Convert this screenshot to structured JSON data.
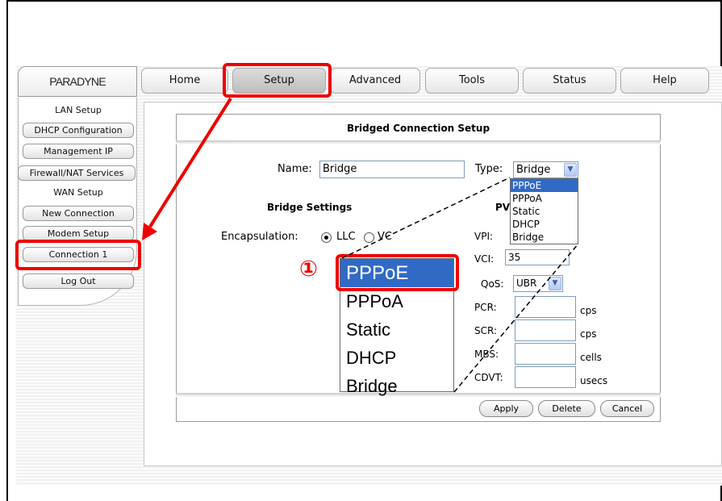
{
  "logo": "PARADYNE",
  "tabs": [
    "Home",
    "Setup",
    "Advanced",
    "Tools",
    "Status",
    "Help"
  ],
  "sidebar": {
    "items": [
      "LAN Setup",
      "DHCP Configuration",
      "Management IP",
      "Firewall/NAT Services",
      "WAN Setup",
      "New Connection",
      "Modem Setup",
      "Connection 1",
      "Log Out"
    ]
  },
  "panel": {
    "title": "Bridged Connection Setup",
    "name_label": "Name:",
    "name_value": "Bridge",
    "type_label": "Type:",
    "type_value": "Bridge",
    "type_options": [
      "PPPoE",
      "PPPoA",
      "Static",
      "DHCP",
      "Bridge"
    ],
    "bridge_settings": "Bridge Settings",
    "pvc_partial": "PV",
    "encapsulation_label": "Encapsulation:",
    "encap_llc": "LLC",
    "encap_vc": "VC",
    "vpi_label": "VPI:",
    "vci_label": "VCI:",
    "vci_value": "35",
    "qos_label": "QoS:",
    "qos_value": "UBR",
    "pcr_label": "PCR:",
    "pcr_unit": "cps",
    "scr_label": "SCR:",
    "scr_unit": "cps",
    "mbs_label": "MBS:",
    "mbs_unit": "cells",
    "cdvt_label": "CDVT:",
    "cdvt_unit": "usecs"
  },
  "buttons": {
    "apply": "Apply",
    "delete": "Delete",
    "cancel": "Cancel"
  },
  "annotation": {
    "step": "①"
  },
  "colors": {
    "highlight_red": "#ef0000",
    "selection_blue": "#316ac5"
  }
}
